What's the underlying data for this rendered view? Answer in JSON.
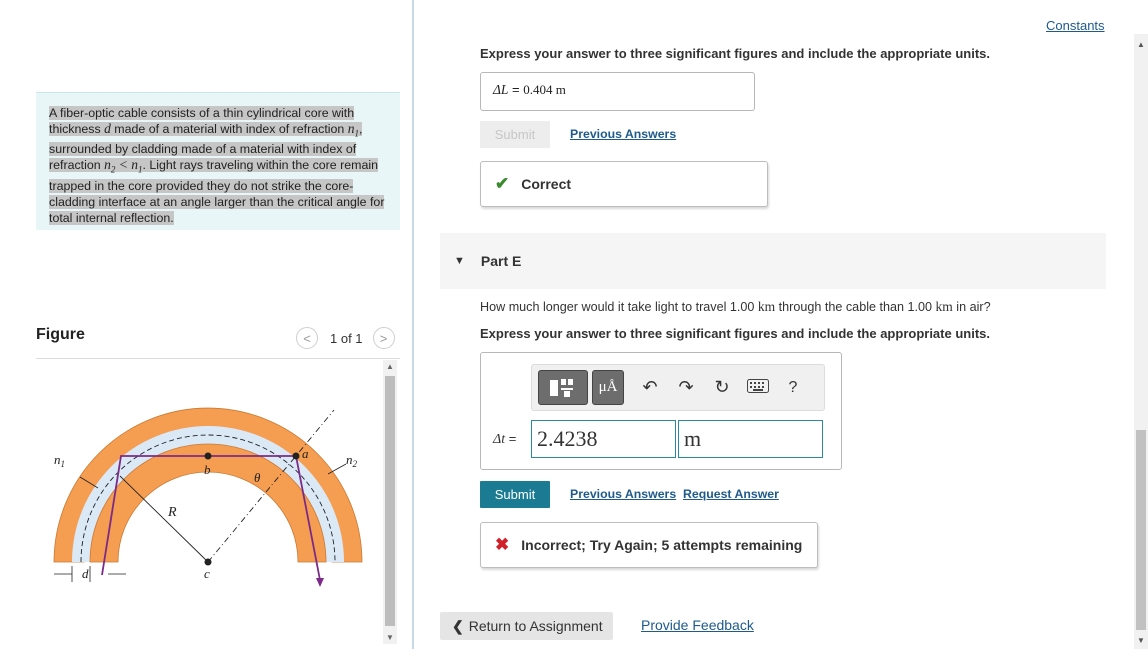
{
  "problem": {
    "text_before_d": "A fiber-optic cable consists of a thin cylindrical core with thickness ",
    "sym_d": "d",
    "text_after_d": " made of a material with index of refraction ",
    "sym_n1": "n",
    "sub_1": "1",
    "text_cladding": ", surrounded by cladding made of a material with index of refraction ",
    "sym_n2": "n",
    "sub_2": "2",
    "lt": " < ",
    "sym_n1b": "n",
    "sub_1b": "1",
    "text_rest": ". Light rays traveling within the core remain trapped in the core provided they do not strike the core-cladding interface at an angle larger than the critical angle for total internal reflection."
  },
  "figure": {
    "title": "Figure",
    "prev_icon": "chevron-left-icon",
    "next_icon": "chevron-right-icon",
    "prev_glyph": "<",
    "next_glyph": ">",
    "count": "1 of 1",
    "labels": {
      "n1": "n",
      "n1_sub": "1",
      "n2": "n",
      "n2_sub": "2",
      "a": "a",
      "b": "b",
      "c": "c",
      "R": "R",
      "theta": "θ",
      "d": "d"
    },
    "colors": {
      "cladding": "#f59d50",
      "core": "#dbe8f6",
      "ray": "#7b2b87"
    }
  },
  "header": {
    "constants_link": "Constants"
  },
  "part_d": {
    "instruction": "Express your answer to three significant figures and include the appropriate units.",
    "answer_symbol": "ΔL",
    "answer_equals": " = ",
    "answer_value": "0.404 m",
    "submit_label": "Submit",
    "previous_answers": "Previous Answers",
    "feedback_icon": "check-icon",
    "feedback_glyph": "✔",
    "feedback": "Correct",
    "feedback_color": "#3a8a2e"
  },
  "part_e": {
    "toggle_icon": "triangle-down-icon",
    "toggle_glyph": "▼",
    "label": "Part E",
    "question_pre": "How much longer would it take light to travel 1.00 ",
    "question_unit1": "km",
    "question_mid": " through the cable than 1.00 ",
    "question_unit2": "km",
    "question_post": " in air?",
    "instruction": "Express your answer to three significant figures and include the appropriate units.",
    "toolbar": {
      "template_icon": "template-icon",
      "units_icon": "units-icon",
      "units_glyph": "μÅ",
      "undo_icon": "undo-icon",
      "undo_glyph": "↶",
      "redo_icon": "redo-icon",
      "redo_glyph": "↷",
      "reset_icon": "reset-icon",
      "reset_glyph": "↻",
      "keyboard_icon": "keyboard-icon",
      "help_icon": "help-icon",
      "help_glyph": "?"
    },
    "dt_label": "Δt",
    "dt_equals": " =",
    "value_input": "2.4238",
    "unit_input": "m",
    "submit_label": "Submit",
    "previous_answers": "Previous Answers",
    "request_answer": "Request Answer",
    "feedback_icon": "x-icon",
    "feedback_glyph": "✖",
    "feedback": "Incorrect; Try Again; 5 attempts remaining",
    "feedback_color": "#d0202a"
  },
  "footer": {
    "return_icon": "chevron-left-icon",
    "return_glyph": "❮",
    "return_label": "Return to Assignment",
    "provide_feedback": "Provide Feedback"
  }
}
